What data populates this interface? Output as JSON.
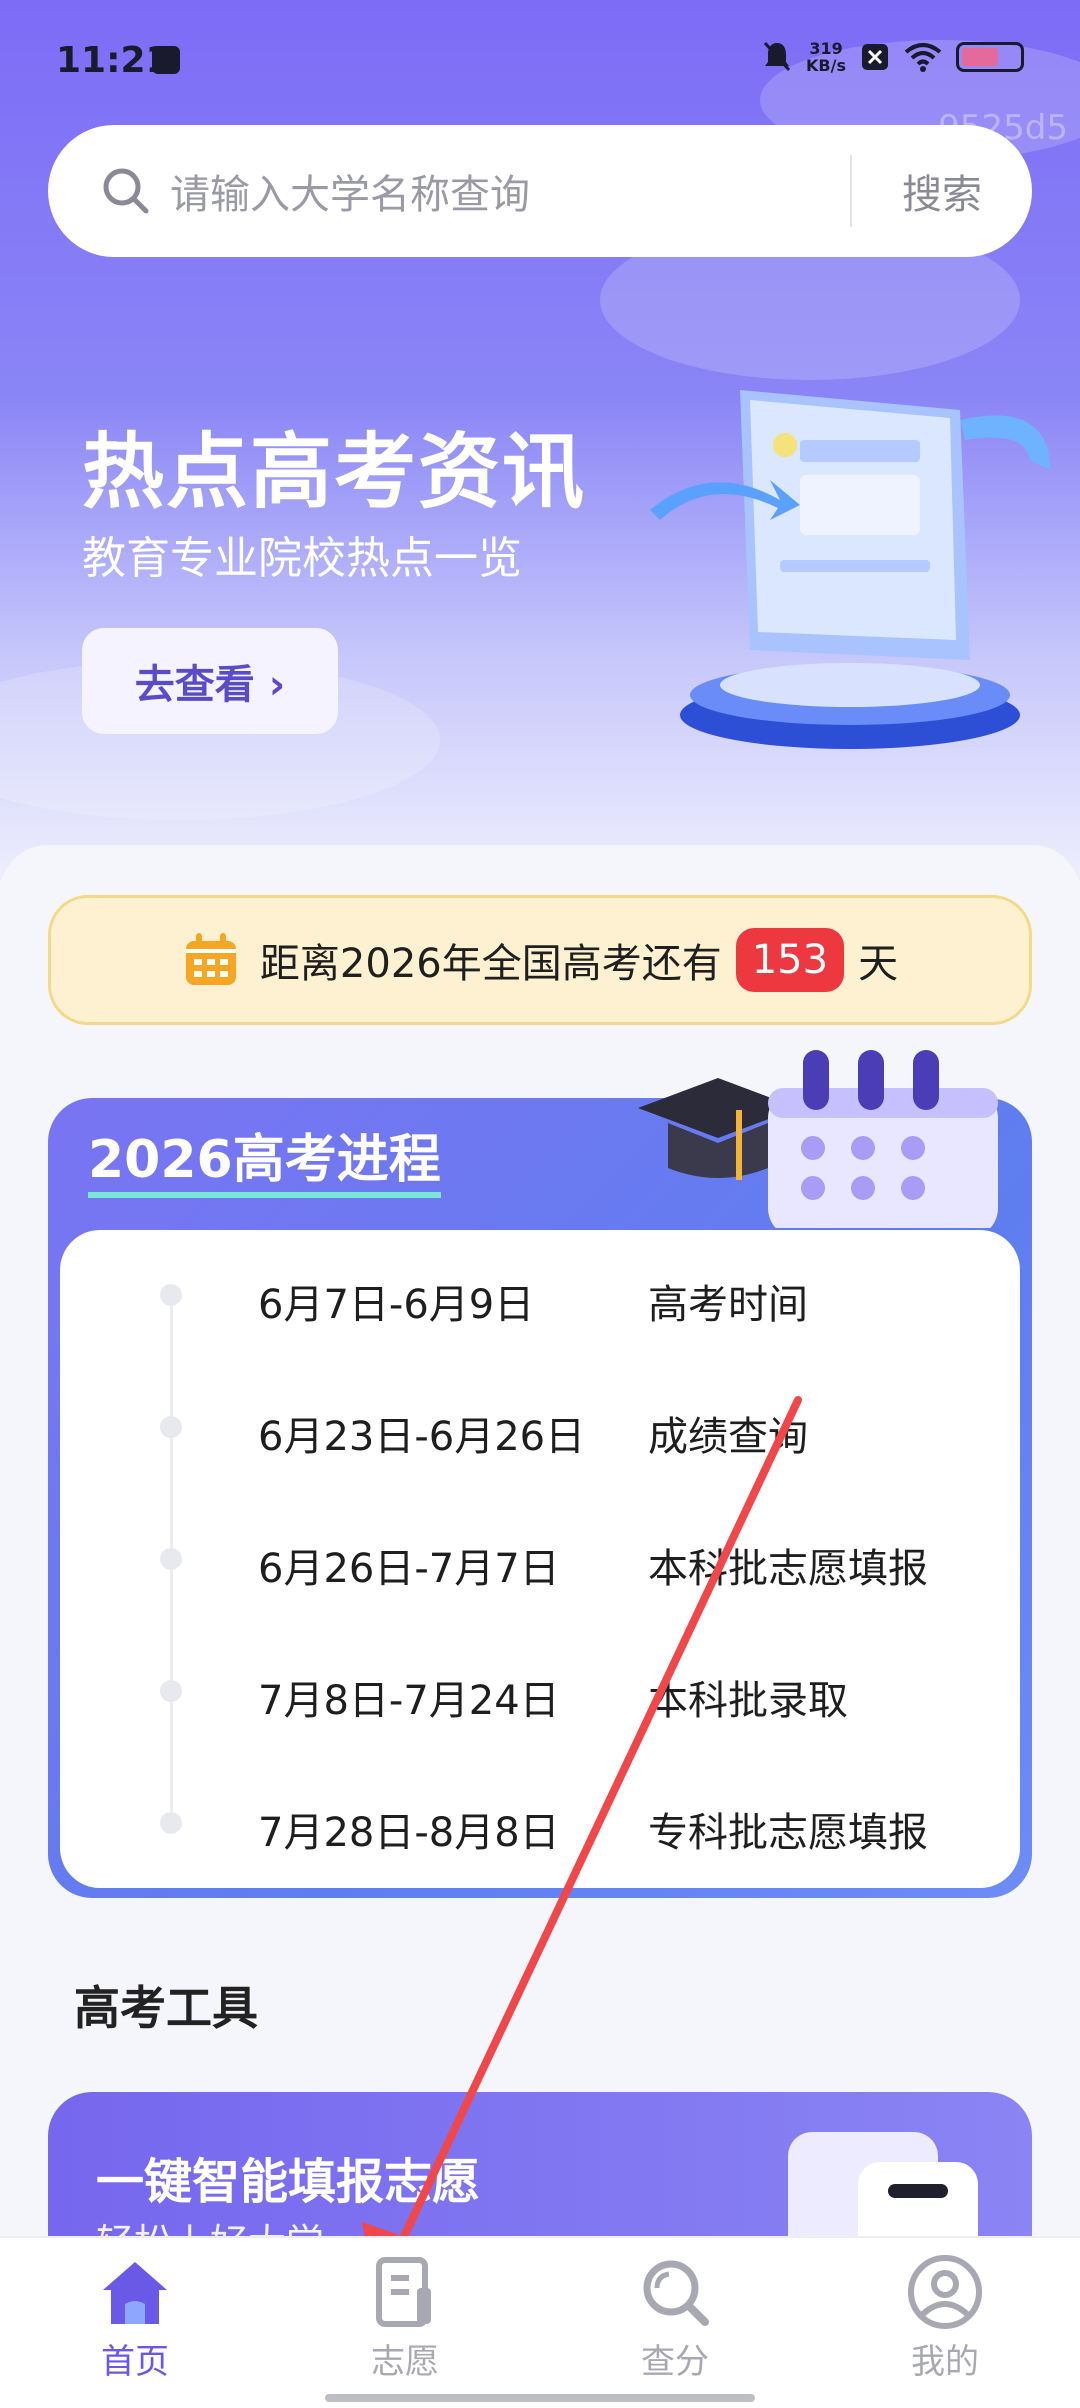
{
  "status_bar": {
    "time": "11:21",
    "net_speed_value": "319",
    "net_speed_unit": "KB/s"
  },
  "watermark": "9525d5",
  "search": {
    "placeholder": "请输入大学名称查询",
    "button_label": "搜索"
  },
  "banner": {
    "title": "热点高考资讯",
    "subtitle": "教育专业院校热点一览",
    "button_label": "去查看 ›"
  },
  "countdown": {
    "prefix": "距离2026年全国高考还有",
    "days": "153",
    "suffix": "天"
  },
  "schedule": {
    "title": "2026高考进程",
    "items": [
      {
        "date": "6月7日-6月9日",
        "event": "高考时间"
      },
      {
        "date": "6月23日-6月26日",
        "event": "成绩查询"
      },
      {
        "date": "6月26日-7月7日",
        "event": "本科批志愿填报"
      },
      {
        "date": "7月8日-7月24日",
        "event": "本科批录取"
      },
      {
        "date": "7月28日-8月8日",
        "event": "专科批志愿填报"
      }
    ]
  },
  "tools": {
    "section_title": "高考工具",
    "card_title": "一键智能填报志愿",
    "card_subtitle": "轻松上好大学"
  },
  "bottom_nav": {
    "items": [
      {
        "label": "首页",
        "icon": "home-icon",
        "active": true
      },
      {
        "label": "志愿",
        "icon": "document-icon",
        "active": false
      },
      {
        "label": "查分",
        "icon": "search-icon",
        "active": false
      },
      {
        "label": "我的",
        "icon": "profile-icon",
        "active": false
      }
    ]
  },
  "colors": {
    "brand": "#7d6cf6",
    "countdown_badge": "#ee3840",
    "annotation_arrow": "#f0474a"
  }
}
